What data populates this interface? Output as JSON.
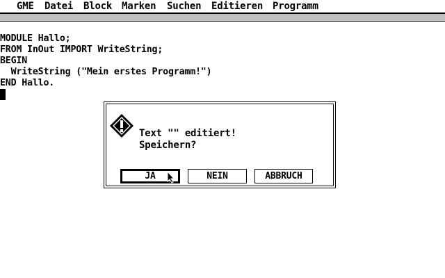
{
  "menubar": {
    "items": [
      "GME",
      "Datei",
      "Block",
      "Marken",
      "Suchen",
      "Editieren",
      "Programm"
    ]
  },
  "editor": {
    "lines": [
      "MODULE Hallo;",
      "FROM InOut IMPORT WriteString;",
      "BEGIN",
      "  WriteString (\"Mein erstes Programm!\")",
      "END Hallo."
    ]
  },
  "dialog": {
    "icon": "exclamation-diamond-icon",
    "message_line1": "Text \"\" editiert!",
    "message_line2": "Speichern?",
    "buttons": {
      "yes": "JA",
      "no": "NEIN",
      "cancel": "ABBRUCH"
    },
    "default_button": "yes"
  },
  "colors": {
    "foreground": "#000000",
    "background": "#ffffff"
  }
}
